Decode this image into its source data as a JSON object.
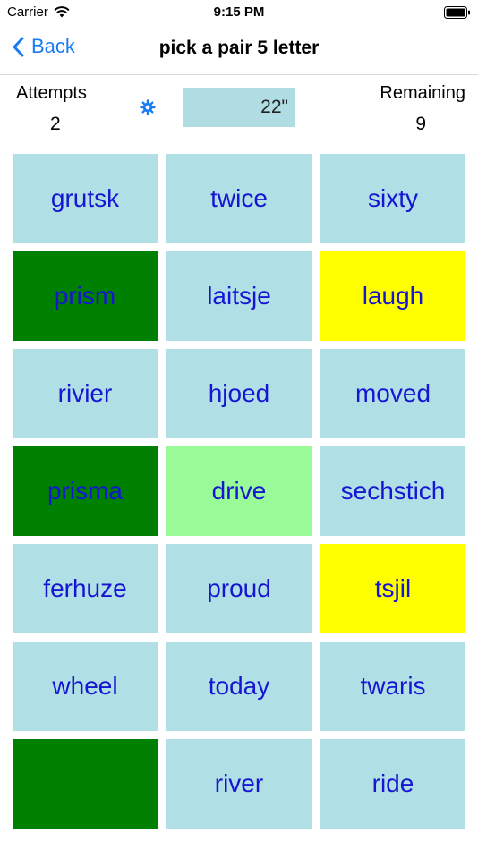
{
  "status_bar": {
    "carrier": "Carrier",
    "time": "9:15 PM"
  },
  "nav": {
    "back_label": "Back",
    "title": "pick a pair 5 letter"
  },
  "stats": {
    "attempts_label": "Attempts",
    "attempts_value": "2",
    "timer": "22\"",
    "remaining_label": "Remaining",
    "remaining_value": "9"
  },
  "tiles": [
    {
      "word": "grutsk",
      "state": "blue"
    },
    {
      "word": "twice",
      "state": "blue"
    },
    {
      "word": "sixty",
      "state": "blue"
    },
    {
      "word": "prism",
      "state": "green"
    },
    {
      "word": "laitsje",
      "state": "blue"
    },
    {
      "word": "laugh",
      "state": "yellow"
    },
    {
      "word": "rivier",
      "state": "blue"
    },
    {
      "word": "hjoed",
      "state": "blue"
    },
    {
      "word": "moved",
      "state": "blue"
    },
    {
      "word": "prisma",
      "state": "green"
    },
    {
      "word": "drive",
      "state": "light-green"
    },
    {
      "word": "sechstich",
      "state": "blue"
    },
    {
      "word": "ferhuze",
      "state": "blue"
    },
    {
      "word": "proud",
      "state": "blue"
    },
    {
      "word": "tsjil",
      "state": "yellow"
    },
    {
      "word": "wheel",
      "state": "blue"
    },
    {
      "word": "today",
      "state": "blue"
    },
    {
      "word": "twaris",
      "state": "blue"
    },
    {
      "word": "",
      "state": "green"
    },
    {
      "word": "river",
      "state": "blue"
    },
    {
      "word": "ride",
      "state": "blue"
    }
  ],
  "colors": {
    "blue": "#b0dfe5",
    "green": "#008000",
    "yellow": "#ffff00",
    "light-green": "#98fb98",
    "word_text": "#1515d2",
    "accent": "#1a7cf5"
  }
}
